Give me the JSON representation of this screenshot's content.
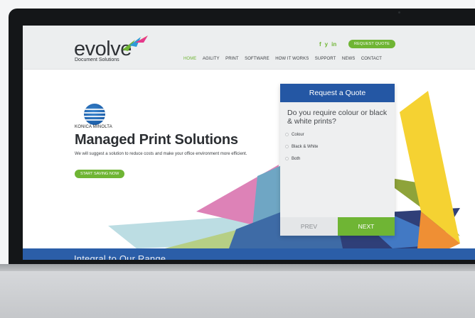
{
  "header": {
    "logo_text": "evolve",
    "logo_sub": "Document Solutions",
    "social_icons": [
      "facebook-icon",
      "twitter-icon",
      "linkedin-icon"
    ],
    "social_glyphs": [
      "f",
      "y",
      "in"
    ],
    "quote_button": "REQUEST QUOTE",
    "nav": [
      {
        "label": "HOME",
        "active": true
      },
      {
        "label": "AGILITY"
      },
      {
        "label": "PRINT"
      },
      {
        "label": "SOFTWARE"
      },
      {
        "label": "HOW IT WORKS"
      },
      {
        "label": "SUPPORT"
      },
      {
        "label": "NEWS"
      },
      {
        "label": "CONTACT"
      }
    ]
  },
  "hero": {
    "brand": "KONICA MINOLTA",
    "title": "Managed Print Solutions",
    "text": "We will suggest a solution to reduce costs and make your office environment more efficient.",
    "button": "START SAVING NOW"
  },
  "quote_widget": {
    "title": "Request a Quote",
    "question": "Do you require colour or black & white prints?",
    "options": [
      "Colour",
      "Black & White",
      "Both"
    ],
    "prev": "PREV",
    "next": "NEXT"
  },
  "banner": {
    "text": "Integral to Our Range"
  },
  "colors": {
    "accent_green": "#6fb534",
    "brand_blue": "#2457a4",
    "header_bg": "#eceeef"
  }
}
